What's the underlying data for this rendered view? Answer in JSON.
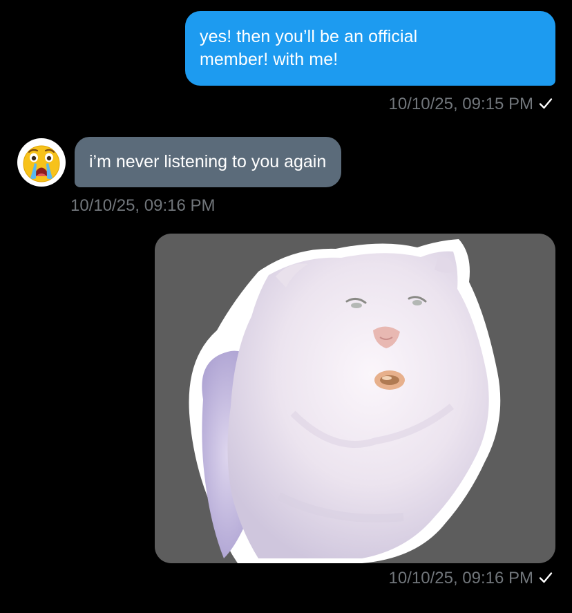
{
  "conversation": {
    "messages": [
      {
        "direction": "outgoing",
        "text": "yes! then you’ll be an official\nmember! with me!",
        "timestamp": "10/10/25, 09:15 PM",
        "status_icon": "checkmark-icon"
      },
      {
        "direction": "incoming",
        "avatar_icon": "crying-emoji-avatar",
        "text": "i’m never listening to you again",
        "timestamp": "10/10/25, 09:16 PM"
      },
      {
        "direction": "outgoing",
        "media": "white-cat-sticker",
        "timestamp": "10/10/25, 09:16 PM",
        "status_icon": "checkmark-icon"
      }
    ]
  },
  "colors": {
    "background": "#000000",
    "outgoing_bubble": "#1d9bf0",
    "incoming_bubble": "#5b6b7a",
    "timestamp_text": "#71767b",
    "media_card": "#5d5d5d"
  }
}
